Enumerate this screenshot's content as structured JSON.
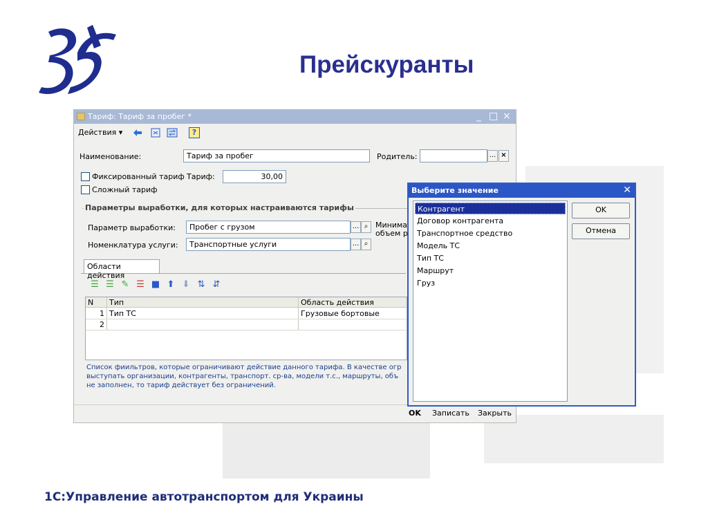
{
  "slide": {
    "title": "Прейскуранты",
    "footer": "1С:Управление автотранспортом для Украины",
    "colors": {
      "title": "#2a2f8f",
      "footer": "#1f2d7a",
      "logo": "#1f2d8f"
    }
  },
  "window": {
    "title": "Тариф: Тариф за пробег *",
    "controls": [
      "_",
      "□",
      "×"
    ],
    "menu": {
      "actions_label": "Действия ▾"
    },
    "toolbar_icons": [
      "arrow-left-icon",
      "report-icon",
      "swap-icon",
      "help-icon"
    ],
    "help_glyph": "?",
    "fields": {
      "name_label": "Наименование:",
      "name_value": "Тариф за пробег",
      "parent_label": "Родитель:",
      "parent_value": "",
      "fixed_tariff_label": "Фиксированный тариф",
      "tariff_label": "Тариф:",
      "tariff_value": "30,00",
      "complex_tariff_label": "Сложный тариф"
    },
    "group": {
      "title": "Параметры выработки, для которых настраиваются тарифы",
      "param_label": "Параметр выработки:",
      "param_value": "Пробег с грузом",
      "service_label": "Номенклатура услуги:",
      "service_value": "Транспортные услуги",
      "min_label_1": "Минима",
      "min_label_2": "объем р"
    },
    "tab": {
      "label": "Области действия"
    },
    "grid": {
      "columns": [
        "N",
        "Тип",
        "Область действия"
      ],
      "rows": [
        {
          "n": "1",
          "type": "Тип ТС",
          "scope": "Грузовые бортовые"
        },
        {
          "n": "2",
          "type": "",
          "scope": ""
        }
      ]
    },
    "description": [
      "Список фиильтров, которые ограничивают действие данного тарифа. В качестве огр",
      "выступать организации, контрагенты, транспорт. ср-ва, модели т.с., маршруты, объ",
      "не заполнен, то тариф действует без ограничений."
    ],
    "bottom_buttons": {
      "ok": "OK",
      "save": "Записать",
      "close": "Закрыть"
    }
  },
  "dialog": {
    "title": "Выберите значение",
    "close": "✕",
    "items": [
      "Контрагент",
      "Договор контрагента",
      "Транспортное средство",
      "Модель ТС",
      "Тип ТС",
      "Маршрут",
      "Груз"
    ],
    "selected_index": 0,
    "ok_label": "OK",
    "cancel_label": "Отмена"
  }
}
